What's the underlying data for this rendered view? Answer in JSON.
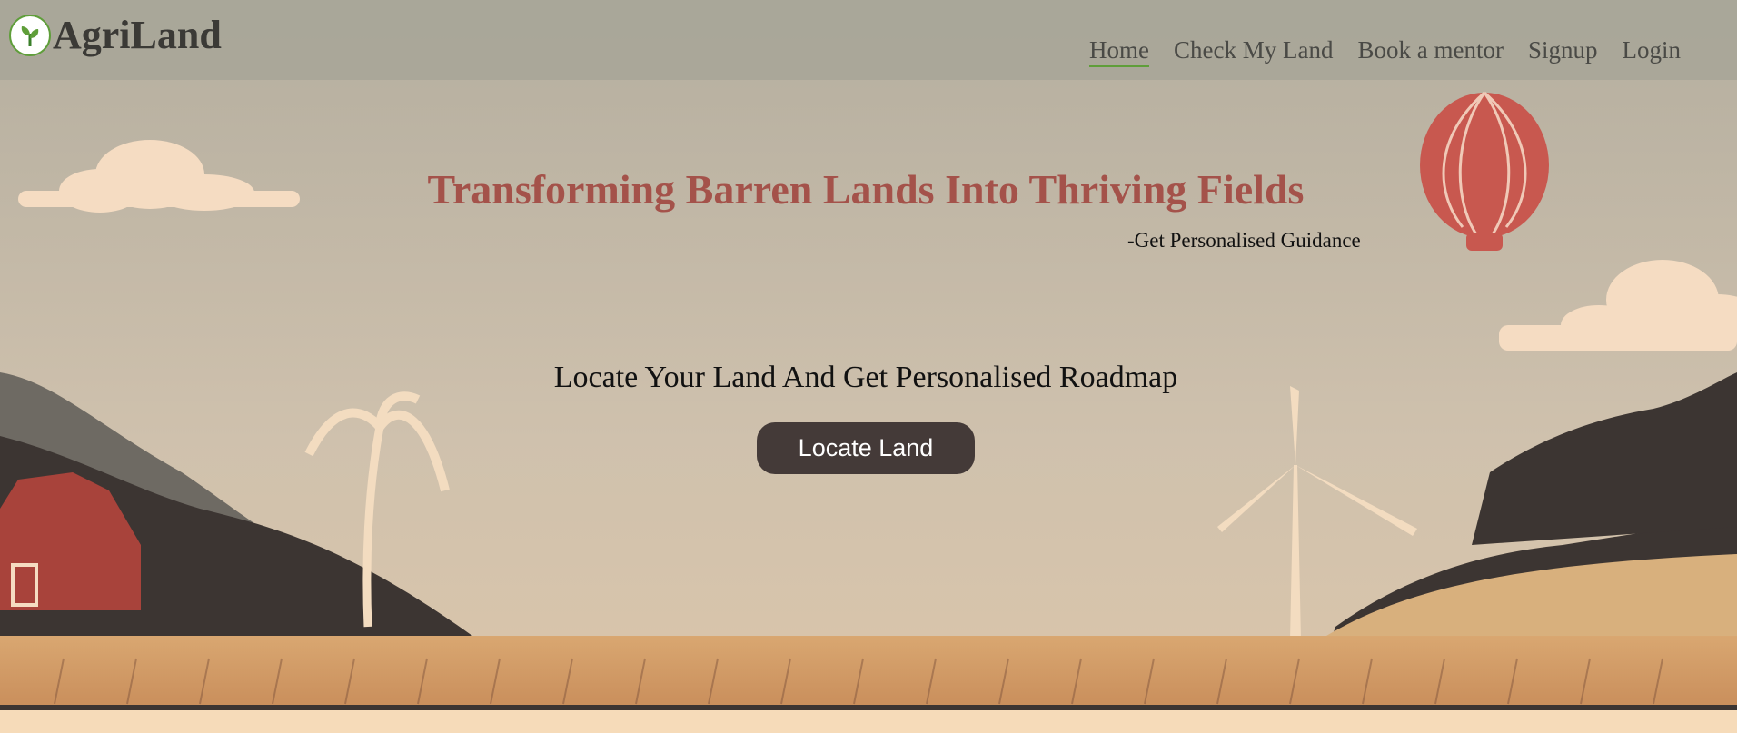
{
  "brand": {
    "name": "AgriLand",
    "logo_icon": "sprout-leaf-icon"
  },
  "nav": {
    "items": [
      {
        "label": "Home",
        "active": true
      },
      {
        "label": "Check My Land",
        "active": false
      },
      {
        "label": "Book a mentor",
        "active": false
      },
      {
        "label": "Signup",
        "active": false
      },
      {
        "label": "Login",
        "active": false
      }
    ]
  },
  "hero": {
    "headline": "Transforming Barren Lands Into Thriving Fields",
    "subline": "-Get Personalised Guidance",
    "cta_text": "Locate Your Land And Get Personalised Roadmap",
    "cta_button": "Locate Land"
  },
  "colors": {
    "headline": "#a4524a",
    "button_bg": "#443a38",
    "nav_bg": "#a8a698",
    "accent_green": "#5f9e3a"
  }
}
